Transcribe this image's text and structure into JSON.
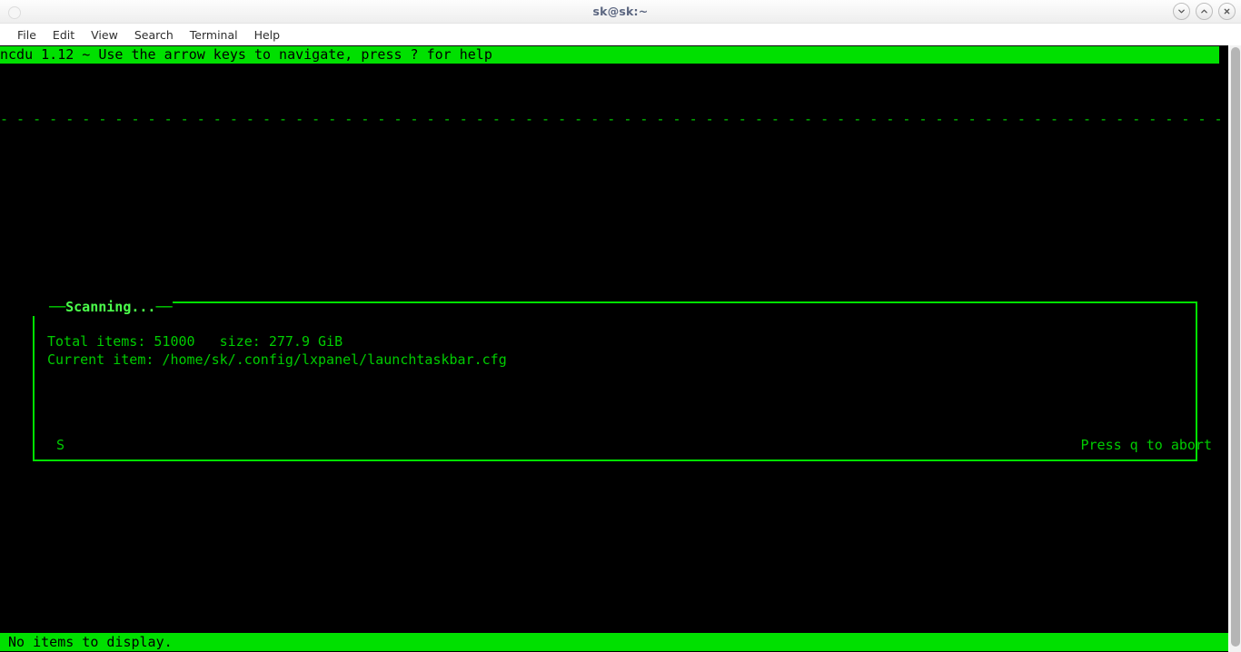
{
  "window": {
    "title": "sk@sk:~",
    "icon": "terminal-circle-icon",
    "controls": [
      {
        "name": "minimize",
        "glyph": "chevron-down-icon"
      },
      {
        "name": "maximize",
        "glyph": "chevron-up-icon"
      },
      {
        "name": "close",
        "glyph": "close-x-icon"
      }
    ]
  },
  "menubar": {
    "items": [
      {
        "label": "File"
      },
      {
        "label": "Edit"
      },
      {
        "label": "View"
      },
      {
        "label": "Search"
      },
      {
        "label": "Terminal"
      },
      {
        "label": "Help"
      }
    ]
  },
  "terminal": {
    "header_text": "ncdu 1.12 ~ Use the arrow keys to navigate, press ? for help",
    "separator_text": "- - - - - - - - - - - - - - - - - - - - - - - - - - - - - - - - - - - - - - - - - - - - - - - - - - - - - - - - - - - - - - - - - - - - - - - - - - - - - - - - - - - - - - - - - - - - - - - - - - - - - - - - - - - - - - - - - - - - - - - - - - - -",
    "status_text": " No items to display.",
    "colors": {
      "background": "#000000",
      "foreground": "#00cc00",
      "bright_green": "#00e000",
      "highlight_text": "#000000",
      "title_green": "#4bff4b"
    }
  },
  "dialog": {
    "title": "Scanning...",
    "title_dashes_left": "─",
    "title_dashes_right": "─",
    "total_items_line": "Total items: 51000   size: 277.9 GiB",
    "total_items_label": "Total items:",
    "total_items_value": "51000",
    "size_label": "size:",
    "size_value": "277.9 GiB",
    "current_item_line": "Current item: /home/sk/.config/lxpanel/launchtaskbar.cfg",
    "current_item_label": "Current item:",
    "current_item_value": "/home/sk/.config/lxpanel/launchtaskbar.cfg",
    "spinner": "S",
    "abort_hint": "Press q to abort"
  },
  "scrollbar": {
    "orientation": "vertical",
    "thumb_position_percent": 0
  }
}
